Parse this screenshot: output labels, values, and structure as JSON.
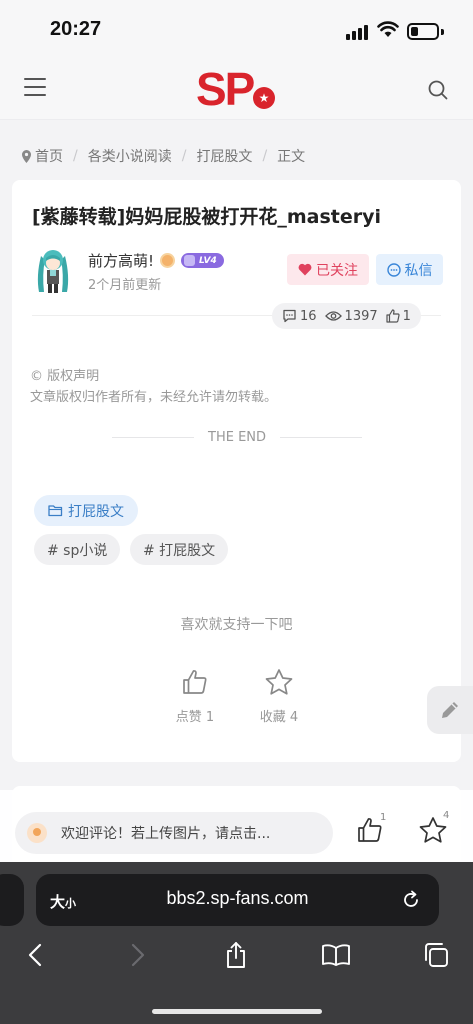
{
  "status_bar": {
    "time": "20:27",
    "battery_level": 0.3
  },
  "header": {
    "logo_text": "SP",
    "logo_dot_glyph": "★",
    "menu_icon": "hamburger-icon",
    "search_icon": "search-icon"
  },
  "breadcrumb": {
    "items": [
      "首页",
      "各类小说阅读",
      "打屁股文",
      "正文"
    ]
  },
  "post": {
    "title": "[紫藤转载]妈妈屁股被打开花_masteryi",
    "author": "前方高萌!",
    "level": "LV4",
    "updated": "2个月前更新",
    "follow_label": "已关注",
    "pm_label": "私信",
    "stats": {
      "comments": "16",
      "views": "1397",
      "likes": "1"
    },
    "copyright_title": "© 版权声明",
    "copyright_text": "文章版权归作者所有，未经允许请勿转载。",
    "end_text": "THE END",
    "category": "打屁股文",
    "tags": [
      "# sp小说",
      "# 打屁股文"
    ],
    "support_text": "喜欢就支持一下吧",
    "like_label": "点赞 1",
    "fav_label": "收藏 4"
  },
  "comment_bar": {
    "placeholder": "欢迎评论！若上传图片，请点击...",
    "like_count": "1",
    "fav_count": "4"
  },
  "browser": {
    "size_label": "大",
    "size_label_small": "小",
    "url": "bbs2.sp-fans.com"
  },
  "colors": {
    "brand_red": "#d9242c",
    "follow_pink": "#e0425e",
    "link_blue": "#3a86d8",
    "level_purple": "#8a6ae0"
  }
}
